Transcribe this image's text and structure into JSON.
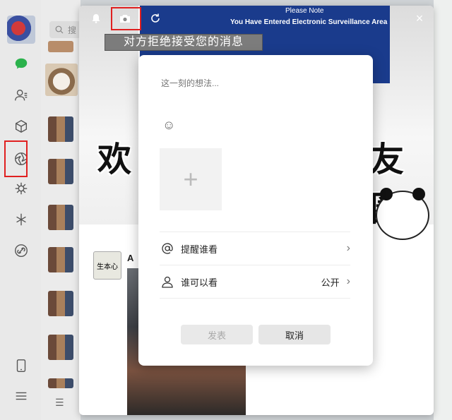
{
  "sidebar": {
    "items": [
      {
        "icon": "chat-bubble-icon",
        "color": "#2bb24c"
      },
      {
        "icon": "contacts-icon"
      },
      {
        "icon": "favorites-cube-icon"
      },
      {
        "icon": "moments-aperture-icon",
        "highlighted": true
      },
      {
        "icon": "channels-icon"
      },
      {
        "icon": "sparkle-icon"
      },
      {
        "icon": "mini-program-link-icon"
      },
      {
        "icon": "phone-icon"
      },
      {
        "icon": "menu-icon"
      }
    ]
  },
  "search": {
    "placeholder": "搜"
  },
  "moments": {
    "banner_note": "Please Note",
    "banner_text": "You Have Entered Electronic Surveillance Area",
    "cover_text_left": "欢",
    "cover_text_right": "友圈",
    "toast": "对方拒绝接受您的消息",
    "close_glyph": "×",
    "post_author": "A ",
    "post_avatar_text": "生本心"
  },
  "dialog": {
    "placeholder": "这一刻的想法...",
    "emoji_glyph": "☺",
    "add_glyph": "+",
    "remind_label": "提醒谁看",
    "visibility_label": "谁可以看",
    "visibility_value": "公开",
    "post_button": "发表",
    "cancel_button": "取消"
  },
  "colors": {
    "highlight": "#e02020",
    "banner": "#1a3b8c",
    "accent_green": "#2bb24c"
  }
}
